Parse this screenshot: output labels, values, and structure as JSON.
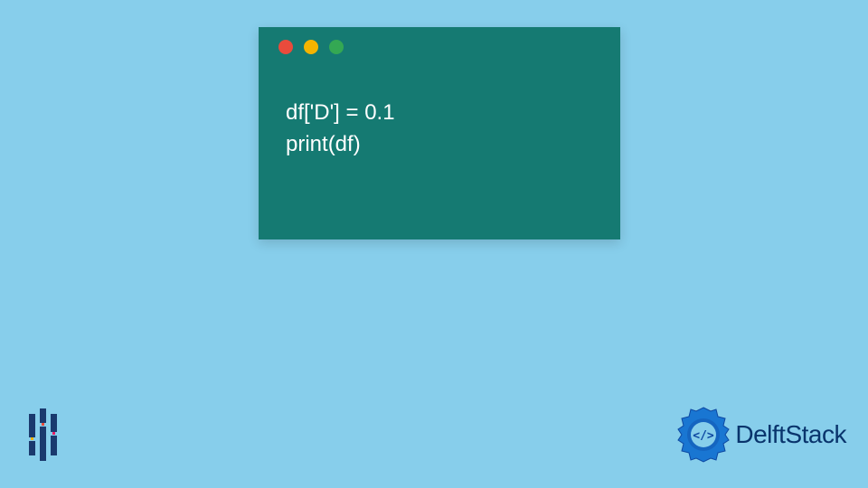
{
  "code_window": {
    "traffic_lights": [
      "red",
      "yellow",
      "green"
    ],
    "lines": [
      "df['D'] = 0.1",
      "print(df)"
    ]
  },
  "brand": {
    "name": "DelftStack"
  },
  "colors": {
    "background": "#87ceeb",
    "code_bg": "#157a72",
    "brand_text": "#09346c",
    "dot_red": "#e94b3c",
    "dot_yellow": "#f4b400",
    "dot_green": "#34a853"
  }
}
